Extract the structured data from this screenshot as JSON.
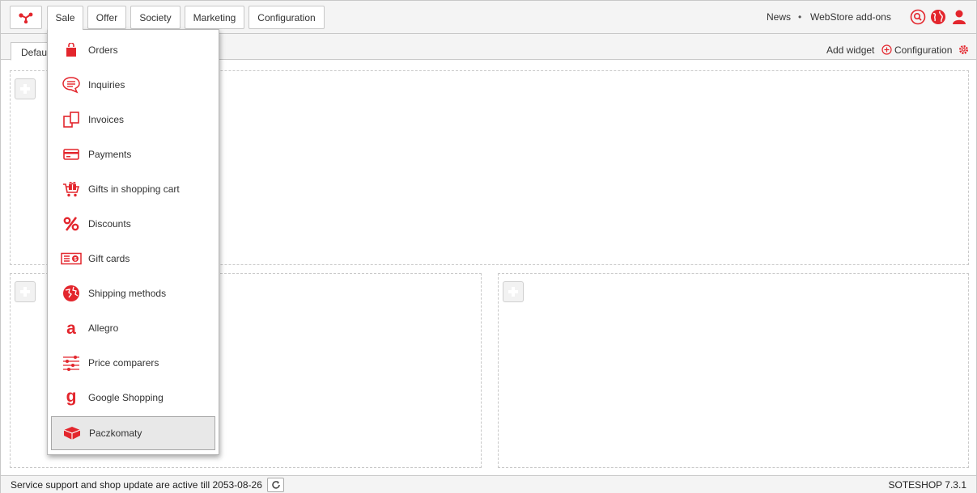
{
  "colors": {
    "accent": "#e3262d",
    "bar_bg": "#f4f4f4",
    "border": "#c8c8c8"
  },
  "topbar": {
    "logo_icon": "molecule-logo-icon",
    "nav": [
      {
        "label": "Sale",
        "active": true
      },
      {
        "label": "Offer"
      },
      {
        "label": "Society"
      },
      {
        "label": "Marketing"
      },
      {
        "label": "Configuration"
      }
    ],
    "right_links": {
      "news": "News",
      "separator": "•",
      "addons": "WebStore add-ons"
    },
    "icons": [
      "search-icon",
      "globe-icon",
      "user-icon"
    ]
  },
  "tabs": {
    "default_label": "Default",
    "add_widget": "Add widget",
    "configuration": "Configuration"
  },
  "sale_menu": [
    {
      "label": "Orders",
      "icon": "shopping-bag-icon"
    },
    {
      "label": "Inquiries",
      "icon": "chat-bubble-icon"
    },
    {
      "label": "Invoices",
      "icon": "documents-icon"
    },
    {
      "label": "Payments",
      "icon": "credit-card-icon"
    },
    {
      "label": "Gifts in shopping cart",
      "icon": "gift-cart-icon"
    },
    {
      "label": "Discounts",
      "icon": "percent-icon"
    },
    {
      "label": "Gift cards",
      "icon": "gift-card-icon"
    },
    {
      "label": "Shipping methods",
      "icon": "globe-shipping-icon"
    },
    {
      "label": "Allegro",
      "icon": "allegro-icon"
    },
    {
      "label": "Price comparers",
      "icon": "sliders-icon"
    },
    {
      "label": "Google Shopping",
      "icon": "google-g-icon"
    },
    {
      "label": "Paczkomaty",
      "icon": "parcel-locker-icon",
      "highlighted": true
    }
  ],
  "footer": {
    "support_text": "Service support and shop update are active till 2053-08-26",
    "version": "SOTESHOP 7.3.1"
  }
}
